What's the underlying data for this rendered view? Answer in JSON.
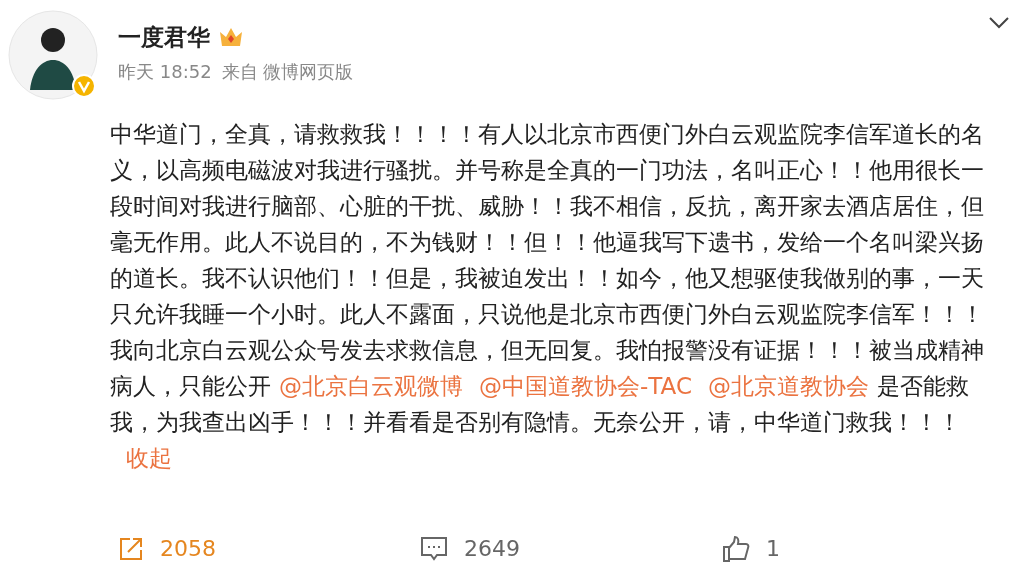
{
  "author": {
    "name": "一度君华",
    "time": "昨天 18:52",
    "source": "来自 微博网页版"
  },
  "body": [
    {
      "kind": "text",
      "text": "中华道门，全真，请救救我！！！！有人以北京市西便门外白云观监院李信军道长的名义，以高频电磁波对我进行骚扰。并号称是全真的一门功法，名叫正心！！他用很长一段时间对我进行脑部、心脏的干扰、威胁！！我不相信，反抗，离开家去酒店居住，但毫无作用。此人不说目的，不为钱财！！但！！他逼我写下遗书，发给一个名叫梁兴扬的道长。我不认识他们！！但是，我被迫发出！！如今，他又想驱使我做别的事，一天只允许我睡一个小时。此人不露面，只说他是北京市西便门外白云观监院李信军！！！我向北京白云观公众号发去求救信息，但无回复。我怕报警没有证据！！！被当成精神病人，只能公开"
    },
    {
      "kind": "mention",
      "text": "@北京白云观微博"
    },
    {
      "kind": "mention",
      "text": "@中国道教协会-TAC"
    },
    {
      "kind": "mention",
      "text": "@北京道教协会"
    },
    {
      "kind": "text",
      "text": "是否能救我，为我查出凶手！！！并看看是否别有隐情。无奈公开，请，中华道门救我！！！"
    },
    {
      "kind": "collapse",
      "text": "收起"
    }
  ],
  "actions": [
    {
      "kind": "share",
      "count": "2058",
      "selected": true
    },
    {
      "kind": "comment",
      "count": "2649",
      "selected": false
    },
    {
      "kind": "like",
      "count": "1",
      "selected": false
    }
  ]
}
